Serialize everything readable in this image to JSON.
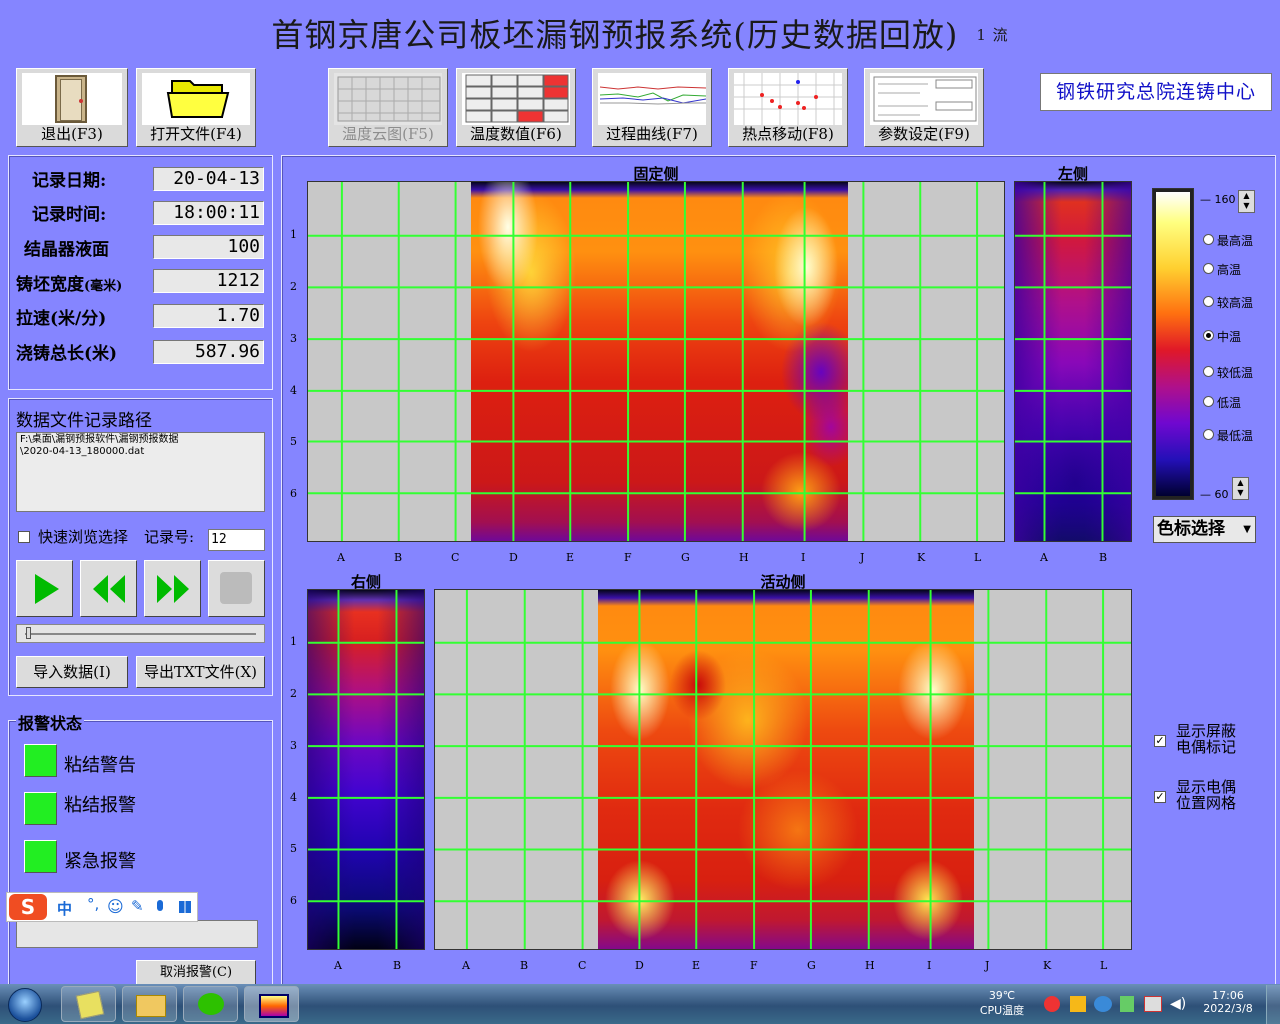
{
  "title": "首钢京唐公司板坯漏钢预报系统(历史数据回放)",
  "strand": "1 流",
  "toolbar": {
    "exit": "退出(F3)",
    "open": "打开文件(F4)",
    "cloud": "温度云图(F5)",
    "values": "温度数值(F6)",
    "curve": "过程曲线(F7)",
    "hotspot": "热点移动(F8)",
    "params": "参数设定(F9)"
  },
  "logo": "钢铁研究总院连铸中心",
  "info": {
    "date_label": "记录日期:",
    "date": "20-04-13",
    "time_label": "记录时间:",
    "time": "18:00:11",
    "level_label": "结晶器液面",
    "level": "100",
    "width_label": "铸坯宽度",
    "width_unit": "(毫米)",
    "width": "1212",
    "speed_label": "拉速(米/分)",
    "speed": "1.70",
    "length_label": "浇铸总长(米)",
    "length": "587.96"
  },
  "file": {
    "title": "数据文件记录路径",
    "path": "F:\\桌面\\漏钢预报软件\\漏钢预报数据\n\\2020-04-13_180000.dat",
    "quick_browse": "快速浏览选择",
    "record_label": "记录号:",
    "record": "12",
    "import_btn": "导入数据(I)",
    "export_btn": "导出TXT文件(X)"
  },
  "alarm": {
    "title": "报警状态",
    "items": [
      "粘结警告",
      "粘结报警",
      "紧急报警"
    ],
    "led_color": "#22ee22",
    "cancel_btn": "取消报警(C)"
  },
  "ime": {
    "lang": "中"
  },
  "maps": {
    "fixed": "固定侧",
    "left": "左侧",
    "right": "右侧",
    "active": "活动侧",
    "row_labels": [
      "1",
      "2",
      "3",
      "4",
      "5",
      "6"
    ],
    "wide_cols": [
      "A",
      "B",
      "C",
      "D",
      "E",
      "F",
      "G",
      "H",
      "I",
      "J",
      "K",
      "L"
    ],
    "narrow_cols": [
      "A",
      "B"
    ]
  },
  "scale": {
    "max": "160",
    "min": "60",
    "levels": [
      "最高温",
      "高温",
      "较高温",
      "中温",
      "较低温",
      "低温",
      "最低温"
    ],
    "selected": "中温",
    "select_label": "色标选择"
  },
  "options": {
    "show_shield": "显示屏蔽电偶标记",
    "show_grid": "显示电偶位置网格"
  },
  "taskbar": {
    "cpu_temp": "39℃",
    "cpu_label": "CPU温度",
    "time": "17:06",
    "date": "2022/3/8"
  }
}
